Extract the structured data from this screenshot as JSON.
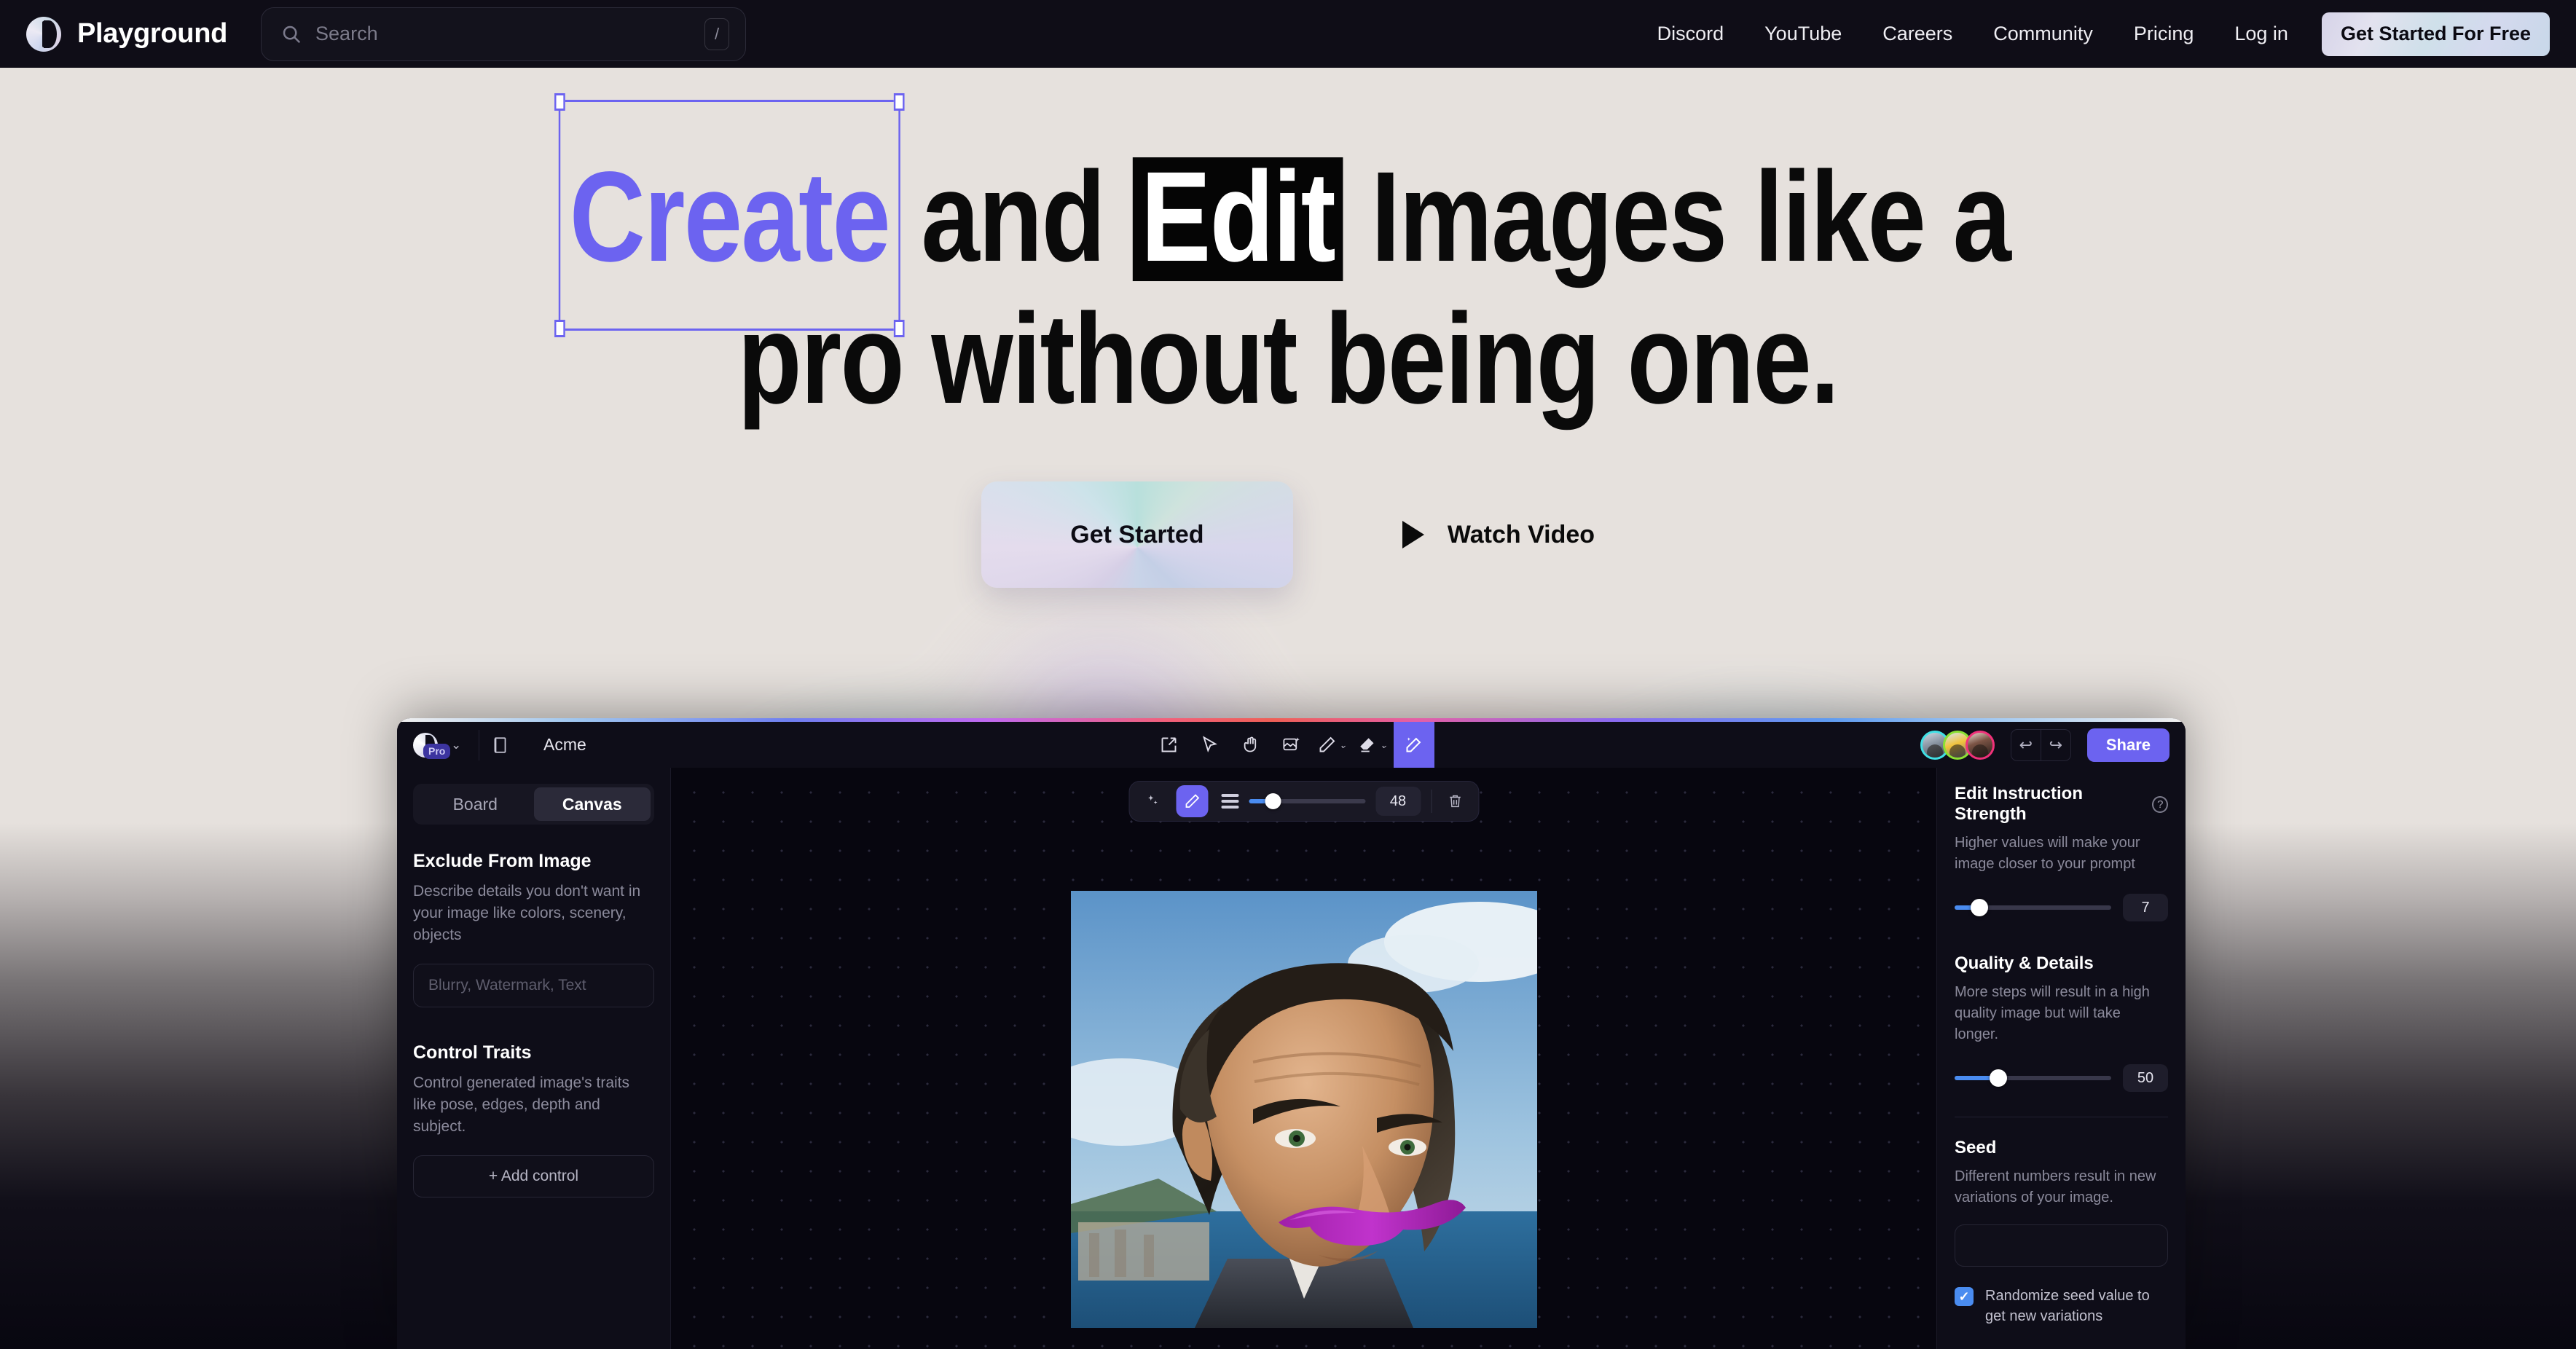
{
  "nav": {
    "brand": "Playground",
    "brand_icon": "playground-logo-icon",
    "search": {
      "placeholder": "Search",
      "shortcut": "/",
      "icon": "search-icon"
    },
    "links": [
      "Discord",
      "YouTube",
      "Careers",
      "Community",
      "Pricing",
      "Log in"
    ],
    "cta": "Get Started For Free",
    "bg": "#0f0d17"
  },
  "hero": {
    "line1_a": "Create",
    "line1_b": "and",
    "line1_c": "Edit",
    "line1_d": "Images like a",
    "line2": "pro without being one.",
    "accent": "#6c63f0",
    "primary_cta": "Get Started",
    "secondary_cta": "Watch Video",
    "secondary_icon": "play-icon"
  },
  "app": {
    "titlebar": {
      "workspace": "Acme",
      "plan_badge": "Pro",
      "logo_icon": "playground-logo-icon",
      "dropdown_icon": "chevron-down-icon",
      "book_icon": "book-icon",
      "tools": [
        {
          "name": "export-icon"
        },
        {
          "name": "cursor-icon"
        },
        {
          "name": "hand-icon"
        },
        {
          "name": "image-magic-icon"
        },
        {
          "name": "pencil-icon",
          "has_chevron": true
        },
        {
          "name": "eraser-icon",
          "has_chevron": true
        },
        {
          "name": "magic-wand-icon",
          "active": true
        }
      ],
      "undo_icon": "undo-icon",
      "redo_icon": "redo-icon",
      "share": "Share",
      "share_color": "#6c63f0",
      "avatars": [
        "collaborator-1",
        "collaborator-2",
        "collaborator-3"
      ]
    },
    "left_panel": {
      "tabs": [
        {
          "label": "Board",
          "active": false
        },
        {
          "label": "Canvas",
          "active": true
        }
      ],
      "sections": [
        {
          "title": "Exclude From Image",
          "desc": "Describe details you don't want in your image like colors, scenery, objects",
          "placeholder": "Blurry, Watermark, Text"
        },
        {
          "title": "Control Traits",
          "desc": "Control generated image's traits like pose, edges, depth and subject.",
          "button": "+  Add control"
        }
      ]
    },
    "canvas": {
      "brush_toolbar": {
        "sparkle_icon": "sparkles-icon",
        "pen_icon": "pen-icon",
        "lines_icon": "brush-size-icon",
        "size_value": "48",
        "size_percent": 18,
        "trash_icon": "trash-icon"
      },
      "artwork_alt": "portrait of a man with a purple mustache on a coastal background"
    },
    "right_panel": {
      "groups": [
        {
          "title": "Edit Instruction Strength",
          "help_icon": "help-icon",
          "desc": "Higher values will make your image closer to your prompt",
          "value": "7",
          "percent": 16
        },
        {
          "title": "Quality & Details",
          "desc": "More steps will result in a high quality image but will take longer.",
          "value": "50",
          "percent": 28
        }
      ],
      "seed": {
        "title": "Seed",
        "desc": "Different numbers result in new variations of your image.",
        "input_value": "",
        "checkbox_label": "Randomize seed value to get new variations",
        "checkbox_checked": true,
        "check_glyph": "✓"
      }
    }
  }
}
